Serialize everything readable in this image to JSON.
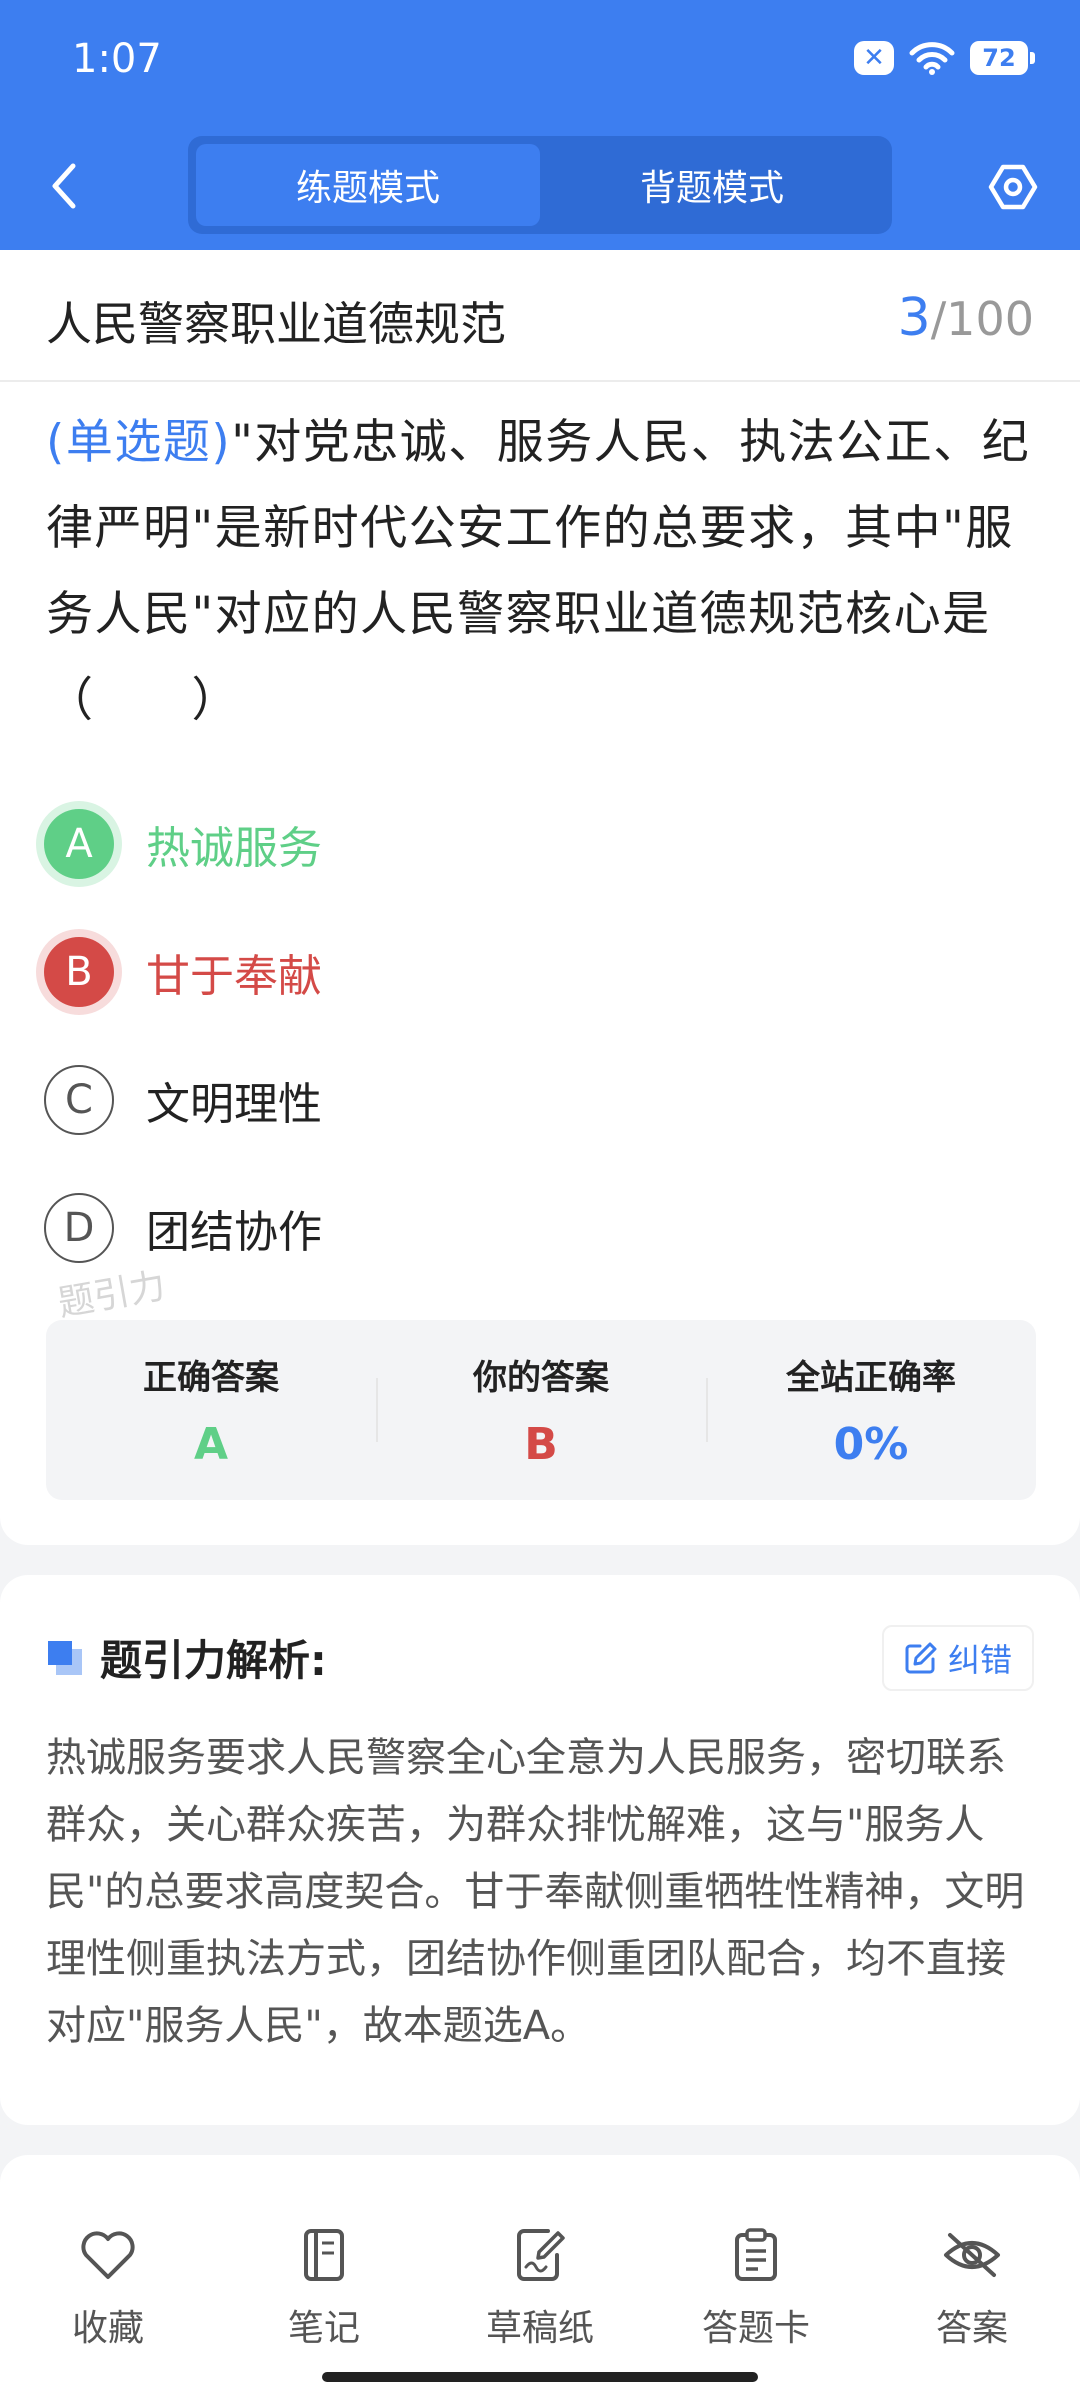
{
  "status": {
    "time": "1:07",
    "battery": "72"
  },
  "header": {
    "modes": [
      "练题模式",
      "背题模式"
    ],
    "active_mode": "练题模式"
  },
  "section": {
    "title": "人民警察职业道德规范",
    "current": "3",
    "total": "/100"
  },
  "question": {
    "type_label": "(单选题)",
    "text": "\"对党忠诚、服务人民、执法公正、纪律严明\"是新时代公安工作的总要求，其中\"服务人民\"对应的人民警察职业道德规范核心是（　　）"
  },
  "options": [
    {
      "letter": "A",
      "text": "热诚服务",
      "state": "correct"
    },
    {
      "letter": "B",
      "text": "甘于奉献",
      "state": "wrong"
    },
    {
      "letter": "C",
      "text": "文明理性",
      "state": "neutral"
    },
    {
      "letter": "D",
      "text": "团结协作",
      "state": "neutral"
    }
  ],
  "watermark": "题引力",
  "stats": {
    "correct_label": "正确答案",
    "correct_value": "A",
    "yours_label": "你的答案",
    "yours_value": "B",
    "rate_label": "全站正确率",
    "rate_value": "0%"
  },
  "analysis": {
    "title": "题引力解析:",
    "report_label": "纠错",
    "text": "热诚服务要求人民警察全心全意为人民服务，密切联系群众，关心群众疾苦，为群众排忧解难，这与\"服务人民\"的总要求高度契合。甘于奉献侧重牺牲性精神，文明理性侧重执法方式，团结协作侧重团队配合，均不直接对应\"服务人民\"，故本题选A。"
  },
  "bottom_nav": [
    {
      "label": "收藏",
      "icon": "heart-icon"
    },
    {
      "label": "笔记",
      "icon": "notebook-icon"
    },
    {
      "label": "草稿纸",
      "icon": "draft-icon"
    },
    {
      "label": "答题卡",
      "icon": "clipboard-icon"
    },
    {
      "label": "答案",
      "icon": "eye-off-icon"
    }
  ],
  "colors": {
    "primary": "#3d7ef0",
    "correct": "#5fcf87",
    "wrong": "#d44a47"
  }
}
